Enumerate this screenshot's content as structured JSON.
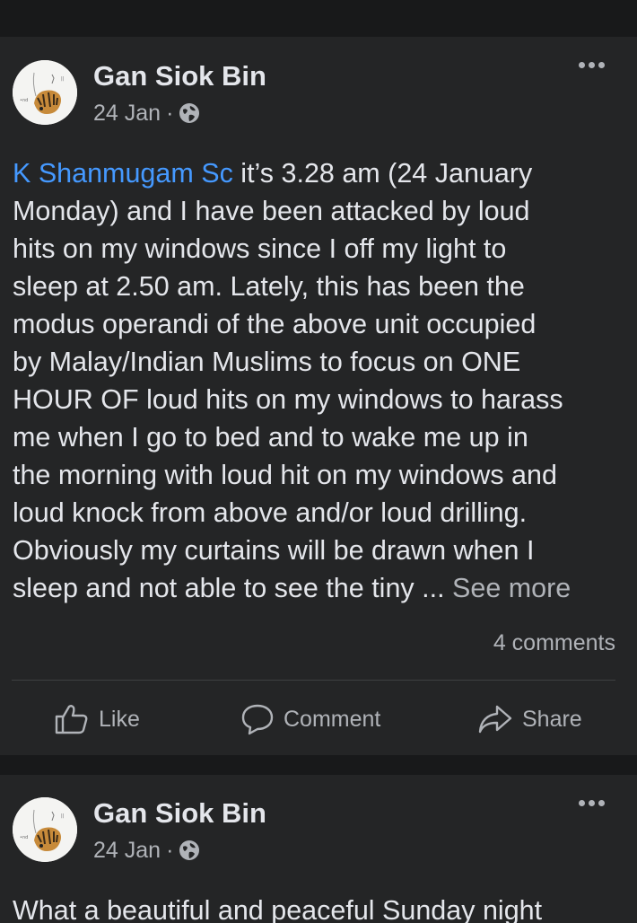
{
  "posts": [
    {
      "author": "Gan Siok Bin",
      "date": "24 Jan",
      "meta_separator": "·",
      "privacy_icon": "globe-icon",
      "mention": "K Shanmugam Sc",
      "text_lines": [
        " it’s 3.28 am (24 January",
        "Monday) and I have been attacked by loud",
        "hits on my windows since I off my light to",
        "sleep at 2.50 am. Lately, this has been the",
        "modus operandi of the above unit occupied",
        "by Malay/Indian Muslims to focus on ONE",
        "HOUR OF loud hits on my windows to harass",
        "me when I go to bed and to wake me up in",
        "the morning with loud hit on my windows and",
        "loud knock from above and/or loud drilling.",
        "Obviously my curtains will be drawn when I",
        "sleep and not able to see the tiny ... "
      ],
      "see_more": "See more",
      "comments_count": "4 comments",
      "actions": {
        "like": "Like",
        "comment": "Comment",
        "share": "Share"
      }
    },
    {
      "author": "Gan Siok Bin",
      "date": "24 Jan",
      "meta_separator": "·",
      "privacy_icon": "globe-icon",
      "text_partial": "What a beautiful and peaceful Sunday night"
    }
  ],
  "colors": {
    "background": "#18191a",
    "card": "#242526",
    "primary_text": "#e4e6eb",
    "secondary_text": "#b0b3b8",
    "link": "#4599ff",
    "divider": "#3e4042"
  }
}
